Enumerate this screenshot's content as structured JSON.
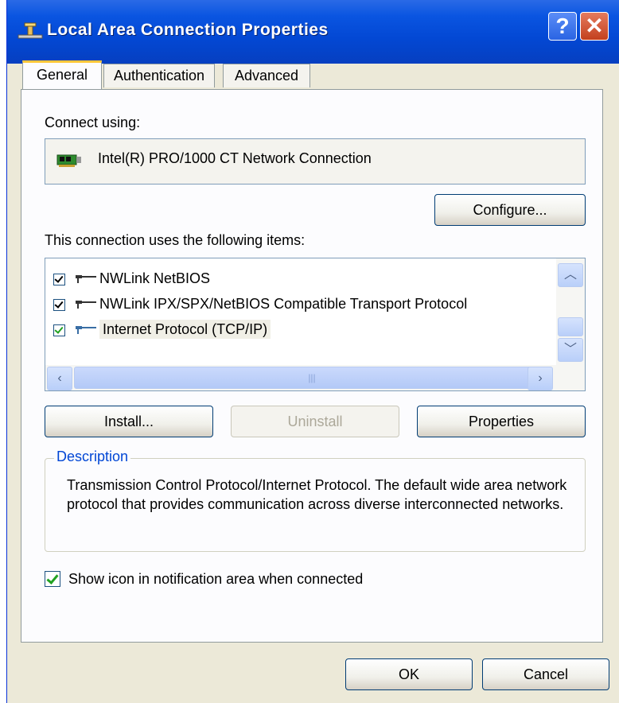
{
  "window": {
    "title": "Local Area Connection Properties",
    "help_label": "?",
    "close_label": "✕"
  },
  "tabs": [
    {
      "label": "General",
      "active": true
    },
    {
      "label": "Authentication",
      "active": false
    },
    {
      "label": "Advanced",
      "active": false
    }
  ],
  "connect": {
    "label": "Connect using:",
    "adapter": "Intel(R) PRO/1000 CT Network Connection",
    "configure_label": "Configure..."
  },
  "items": {
    "label": "This connection uses the following items:",
    "list": [
      {
        "name": "NWLink NetBIOS",
        "checked": true
      },
      {
        "name": "NWLink IPX/SPX/NetBIOS Compatible Transport Protocol",
        "checked": true
      },
      {
        "name": "Internet Protocol (TCP/IP)",
        "checked": true,
        "selected": true
      }
    ]
  },
  "buttons": {
    "install": "Install...",
    "uninstall": "Uninstall",
    "properties": "Properties",
    "ok": "OK",
    "cancel": "Cancel"
  },
  "description": {
    "title": "Description",
    "text": "Transmission Control Protocol/Internet Protocol. The default wide area network protocol that provides communication across diverse interconnected networks."
  },
  "notification": {
    "label": "Show icon in notification area when connected",
    "checked": true
  },
  "colors": {
    "titlebar": "#0348d4",
    "dialog_bg": "#ece9d8",
    "tab_highlight": "#ffc83c",
    "groupbox_title": "#0046d5"
  }
}
